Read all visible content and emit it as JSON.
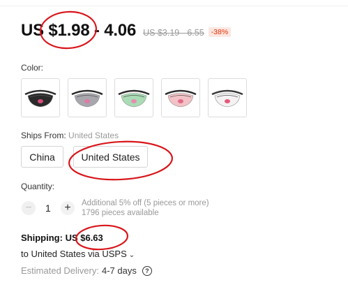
{
  "price": {
    "range": "US $1.98 - 4.06",
    "original": "US $3.19 - 6.55",
    "discount": "-38%"
  },
  "color": {
    "label": "Color:",
    "options": [
      {
        "name": "black-bag-thumb",
        "bag_color": "#2a2a2a",
        "accent": "#d84a7a"
      },
      {
        "name": "grey-bag-thumb",
        "bag_color": "#a8a7ad",
        "accent": "#e07aa6"
      },
      {
        "name": "green-bag-thumb",
        "bag_color": "#a9dcb4",
        "accent": "#e58db2"
      },
      {
        "name": "pink-bag-thumb",
        "bag_color": "#f2c2c6",
        "accent": "#e26b89"
      },
      {
        "name": "white-bag-thumb",
        "bag_color": "#f4f2f2",
        "accent": "#e45a7c"
      }
    ]
  },
  "ships_from": {
    "label": "Ships From:",
    "selected": "United States",
    "options": [
      "China",
      "United States"
    ]
  },
  "quantity": {
    "label": "Quantity:",
    "value": "1",
    "minus": "−",
    "plus": "+",
    "note_line1": "Additional 5% off (5 pieces or more)",
    "note_line2": "1796 pieces available"
  },
  "shipping": {
    "label": "Shipping:",
    "amount": "US $6.63",
    "to_text": "to United States via USPS",
    "delivery_label": "Estimated Delivery:",
    "delivery_days": "4-7 days",
    "help": "?"
  },
  "colors": {
    "annotation_red": "#d8161b",
    "discount_red": "#e62e04"
  }
}
